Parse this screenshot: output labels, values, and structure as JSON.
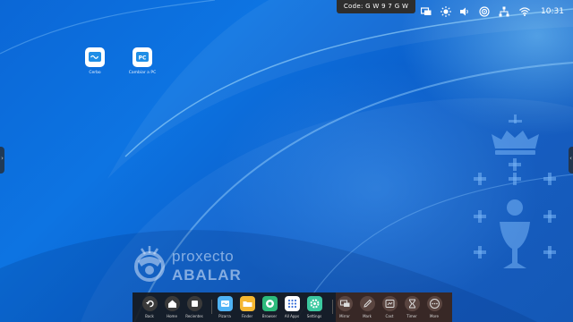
{
  "status_bar": {
    "code_label": "Code:",
    "code_value": "G W 9 7 G W",
    "time": "10:31",
    "icons": [
      "screen-mirror-icon",
      "brightness-icon",
      "volume-icon",
      "hotspot-icon",
      "network-icon",
      "wifi-icon"
    ]
  },
  "desktop": {
    "apps": [
      {
        "label": "Cerbo",
        "icon": "whiteboard-icon",
        "color": "#1e8ee6"
      },
      {
        "label": "Cambiar a PC",
        "icon": "pc-icon",
        "color": "#1e8ee6"
      }
    ],
    "logo": {
      "top": "proxecto",
      "bottom": "ABALAR"
    }
  },
  "dock": {
    "items": [
      {
        "label": "Back",
        "icon": "back-icon"
      },
      {
        "label": "Home",
        "icon": "home-icon"
      },
      {
        "label": "Recientes",
        "icon": "recent-apps-icon"
      },
      {
        "label": "Pizarra",
        "icon": "whiteboard-icon",
        "color": "#4fb3f5"
      },
      {
        "label": "Finder",
        "icon": "folder-icon",
        "color": "#f5b731"
      },
      {
        "label": "Browser",
        "icon": "browser-icon",
        "color": "#2dbb7c"
      },
      {
        "label": "All Apps",
        "icon": "all-apps-icon",
        "color": "#ffffff"
      },
      {
        "label": "Settings",
        "icon": "settings-icon",
        "color": "#3cc9a0"
      },
      {
        "label": "Mirror",
        "icon": "mirror-icon"
      },
      {
        "label": "Mark",
        "icon": "pen-icon"
      },
      {
        "label": "Cast",
        "icon": "cast-icon"
      },
      {
        "label": "Timer",
        "icon": "hourglass-icon"
      },
      {
        "label": "More",
        "icon": "more-icon"
      }
    ]
  }
}
